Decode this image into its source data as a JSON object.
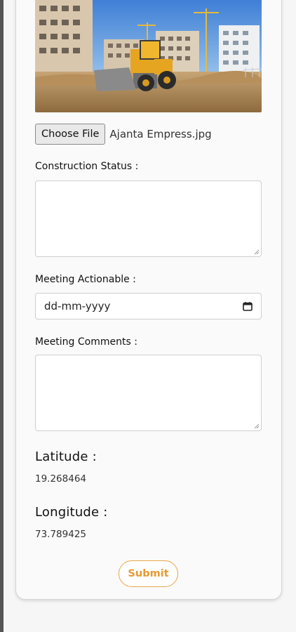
{
  "file_input": {
    "button_label": "Choose File",
    "file_name": "Ajanta Empress.jpg"
  },
  "construction_status": {
    "label": "Construction Status :",
    "value": ""
  },
  "meeting_actionable": {
    "label": "Meeting Actionable :",
    "placeholder": "dd-mm-yyyy"
  },
  "meeting_comments": {
    "label": "Meeting Comments :",
    "value": ""
  },
  "latitude": {
    "label": "Latitude :",
    "value": "19.268464"
  },
  "longitude": {
    "label": "Longitude :",
    "value": "73.789425"
  },
  "submit_label": "Submit",
  "colors": {
    "accent": "#e59a35",
    "accent_border": "#e8a54a"
  },
  "icons": {
    "calendar": "calendar-icon",
    "resize": "resize-handle-icon"
  }
}
